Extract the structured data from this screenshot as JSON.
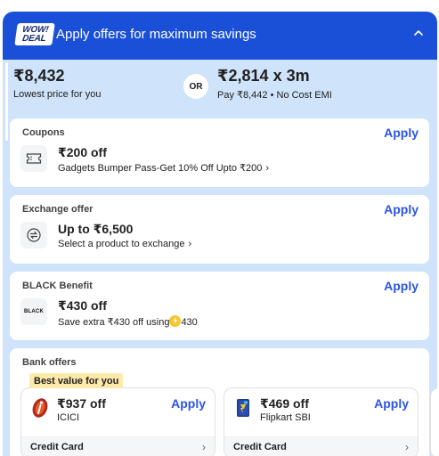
{
  "header": {
    "badge_line1": "WOW!",
    "badge_line2": "DEAL",
    "title": "Apply offers for maximum savings"
  },
  "pricing": {
    "lowest_price": "₹8,432",
    "lowest_price_label": "Lowest price for you",
    "or_label": "OR",
    "emi_price": "₹2,814 x 3m",
    "emi_label": "Pay ₹8,442 • No Cost EMI"
  },
  "coupons": {
    "title": "Coupons",
    "apply": "Apply",
    "amount": "₹200 off",
    "description": "Gadgets Bumper Pass-Get 10% Off Upto ₹200",
    "icon": "ticket-icon"
  },
  "exchange": {
    "title": "Exchange offer",
    "apply": "Apply",
    "amount": "Up to ₹6,500",
    "description": "Select a product to exchange",
    "icon": "exchange-icon"
  },
  "black": {
    "title": "BLACK Benefit",
    "apply": "Apply",
    "amount": "₹430 off",
    "description_prefix": "Save extra ₹430 off using",
    "coin_amount": "430",
    "logo_text": "BLACK"
  },
  "bank": {
    "title": "Bank offers",
    "best_badge": "Best value for you",
    "offers": [
      {
        "amount": "₹937 off",
        "bank": "ICICI",
        "apply": "Apply",
        "card_type": "Credit Card",
        "icon": "icici-logo-icon"
      },
      {
        "amount": "₹469 off",
        "bank": "Flipkart SBI",
        "apply": "Apply",
        "card_type": "Credit Card",
        "icon": "flipkart-sbi-card-icon"
      }
    ]
  },
  "colors": {
    "header_blue": "#1a50d8",
    "panel_bg": "#cfe3fb",
    "apply_blue": "#2a55e5",
    "badge_yellow": "#fde9a9"
  }
}
